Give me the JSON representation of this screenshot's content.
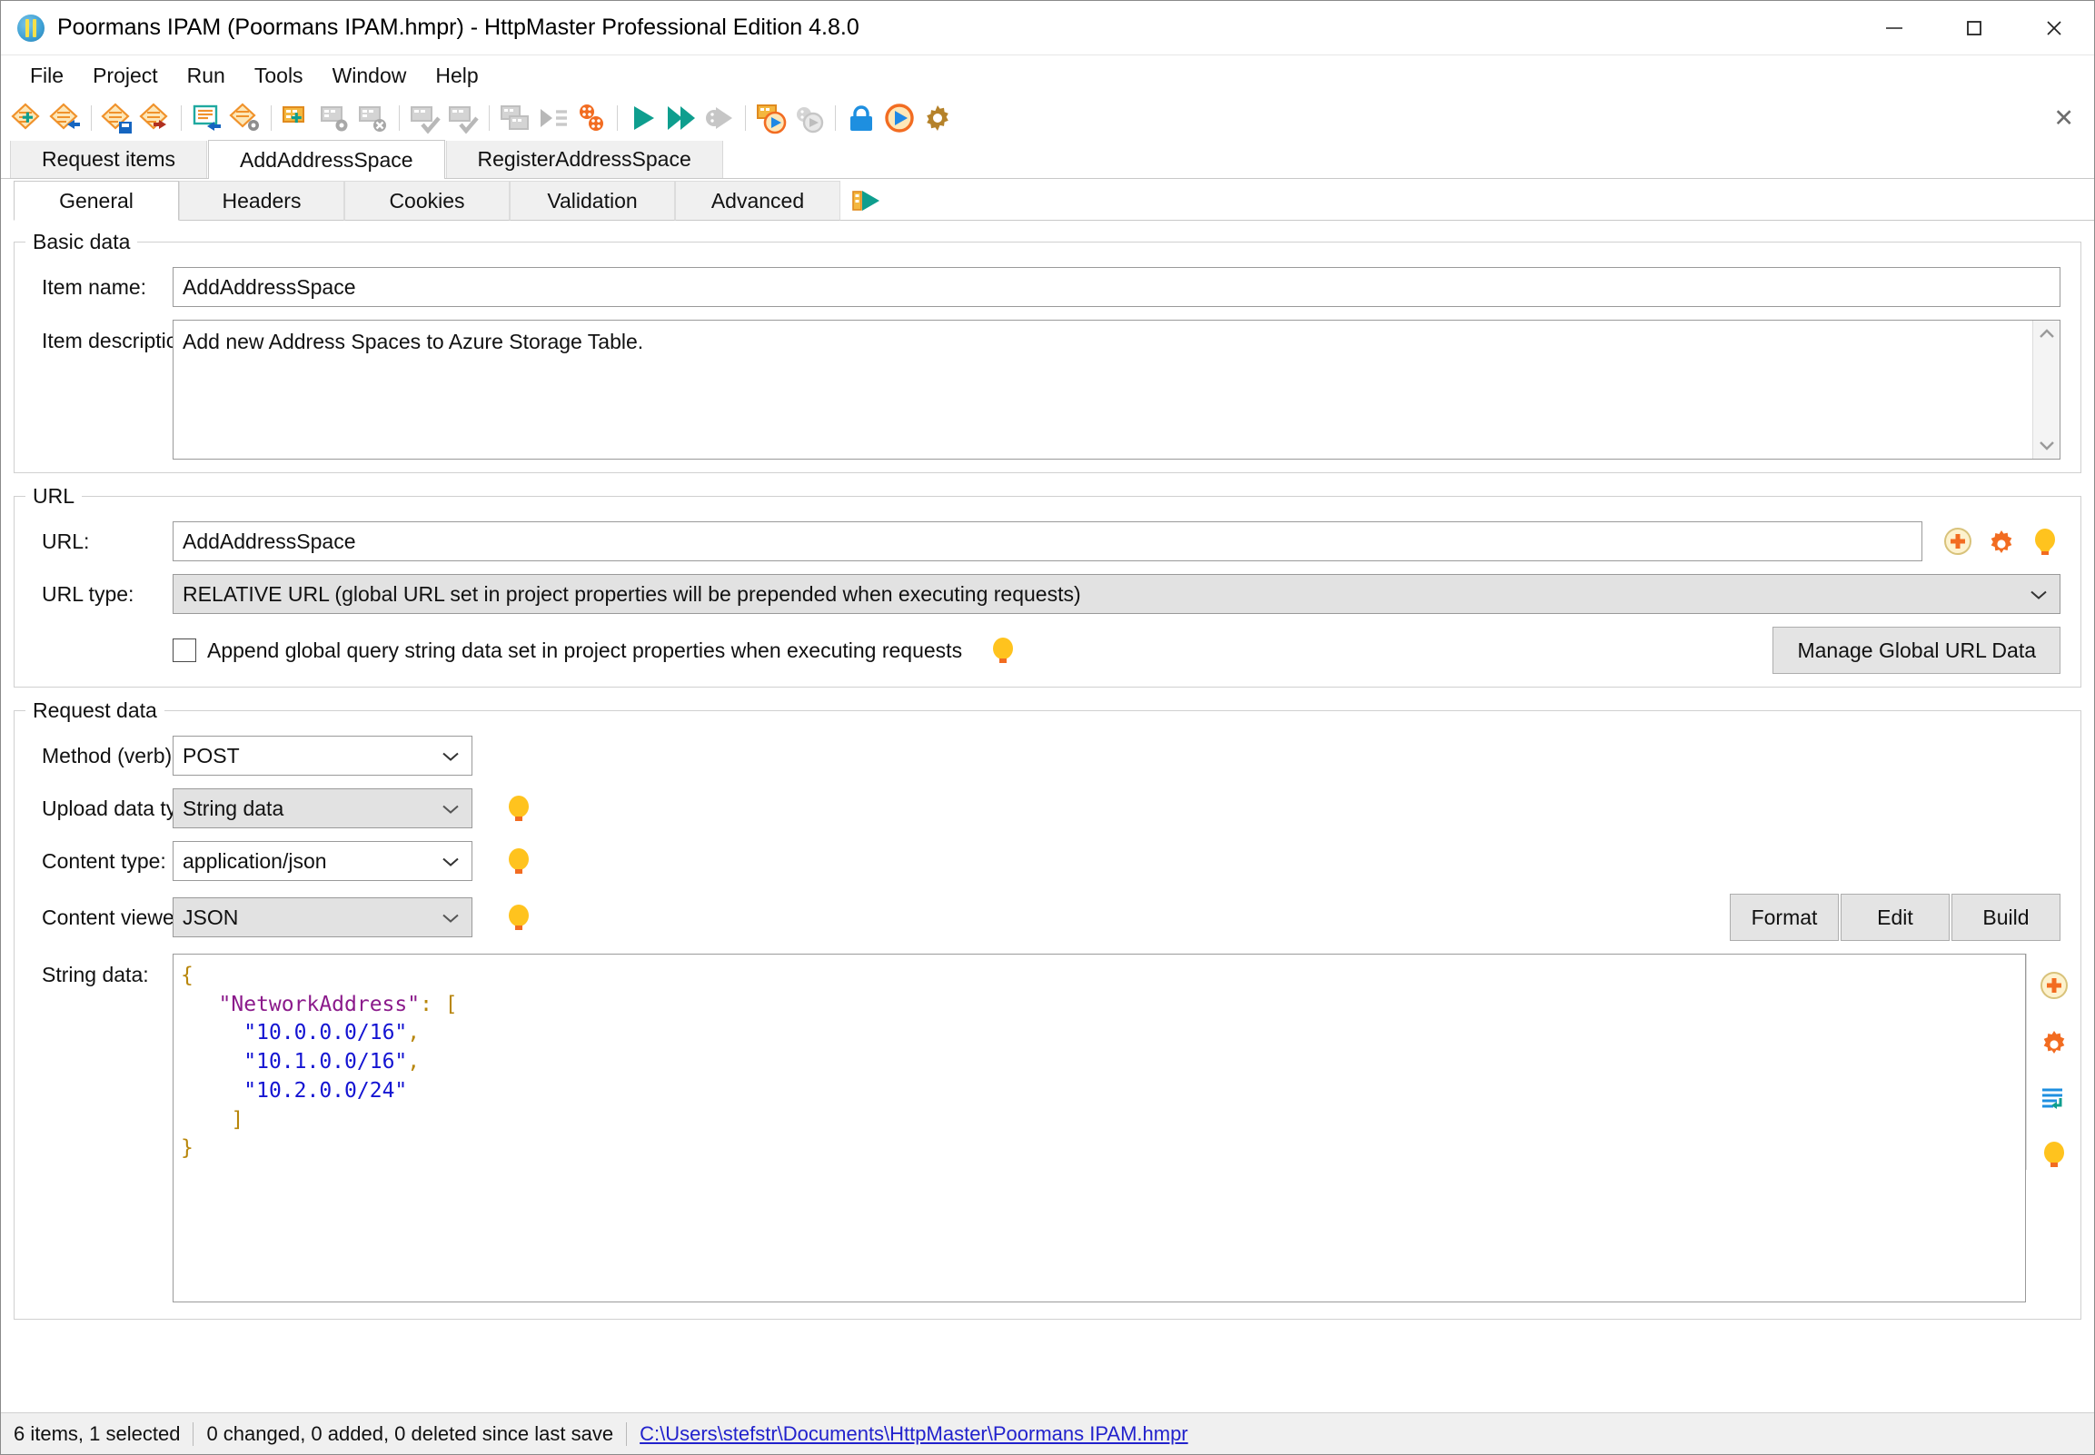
{
  "window": {
    "title": "Poormans IPAM (Poormans IPAM.hmpr) - HttpMaster Professional Edition 4.8.0",
    "app_icon": "httpmaster-logo-icon",
    "minimize_label": "minimize",
    "maximize_label": "maximize",
    "close_label": "close"
  },
  "menubar": {
    "items": [
      {
        "label": "File"
      },
      {
        "label": "Project"
      },
      {
        "label": "Run"
      },
      {
        "label": "Tools"
      },
      {
        "label": "Window"
      },
      {
        "label": "Help"
      }
    ]
  },
  "toolbar": {
    "close_glyph": "✕",
    "buttons": [
      {
        "name": "new-request-item"
      },
      {
        "name": "open-request-item"
      },
      {
        "name": "save-request-item"
      },
      {
        "name": "export-request-item"
      },
      {
        "name": "duplicate-item"
      },
      {
        "name": "item-settings"
      },
      {
        "name": "add-table-row"
      },
      {
        "name": "table-settings"
      },
      {
        "name": "table-delete"
      },
      {
        "name": "table-check"
      },
      {
        "name": "table-check-all"
      },
      {
        "name": "table-copy"
      },
      {
        "name": "run-list"
      },
      {
        "name": "batch-run"
      },
      {
        "name": "execute-request"
      },
      {
        "name": "execute-all-requests"
      },
      {
        "name": "execute-selected-disabled"
      },
      {
        "name": "execute-with-data"
      },
      {
        "name": "execute-with-data-disabled"
      },
      {
        "name": "lock-project"
      },
      {
        "name": "run-monitor"
      },
      {
        "name": "options"
      }
    ]
  },
  "outer_tabs": {
    "items": [
      {
        "label": "Request items",
        "active": false
      },
      {
        "label": "AddAddressSpace",
        "active": true
      },
      {
        "label": "RegisterAddressSpace",
        "active": false
      }
    ]
  },
  "inner_tabs": {
    "items": [
      {
        "label": "General",
        "active": true
      },
      {
        "label": "Headers",
        "active": false
      },
      {
        "label": "Cookies",
        "active": false
      },
      {
        "label": "Validation",
        "active": false
      },
      {
        "label": "Advanced",
        "active": false
      }
    ],
    "run_icon": "execute-request-icon"
  },
  "basic_data": {
    "legend": "Basic data",
    "item_name_label": "Item name:",
    "item_name_value": "AddAddressSpace",
    "item_description_label": "Item description:",
    "item_description_value": "Add new Address Spaces to Azure Storage Table."
  },
  "url_section": {
    "legend": "URL",
    "url_label": "URL:",
    "url_value": "AddAddressSpace",
    "url_type_label": "URL type:",
    "url_type_value": "RELATIVE URL (global URL set in project properties will be prepended when executing requests)",
    "append_checkbox_label": "Append global query string data set in project properties when executing requests",
    "append_checkbox_checked": false,
    "manage_button_label": "Manage Global URL Data"
  },
  "request_data": {
    "legend": "Request data",
    "method_label": "Method (verb):",
    "method_value": "POST",
    "upload_type_label": "Upload data type:",
    "upload_type_value": "String data",
    "content_type_label": "Content type:",
    "content_type_value": "application/json",
    "content_viewer_label": "Content viewer:",
    "content_viewer_value": "JSON",
    "string_data_label": "String data:",
    "format_button": "Format",
    "edit_button": "Edit",
    "build_button": "Build",
    "json_key": "NetworkAddress",
    "json_values": [
      "10.0.0.0/16",
      "10.1.0.0/16",
      "10.2.0.0/24"
    ]
  },
  "statusbar": {
    "items_text": "6 items, 1 selected",
    "changes_text": "0 changed, 0 added, 0 deleted since last save",
    "file_path": "C:\\Users\\stefstr\\Documents\\HttpMaster\\Poormans IPAM.hmpr"
  },
  "colors": {
    "accent_orange": "#F47B20",
    "accent_teal": "#0E9E8E",
    "bulb_yellow": "#FFC31E",
    "link_blue": "#2222CC",
    "json_punct": "#B8860B",
    "json_key": "#8B1A8B",
    "json_string": "#1414D2"
  }
}
